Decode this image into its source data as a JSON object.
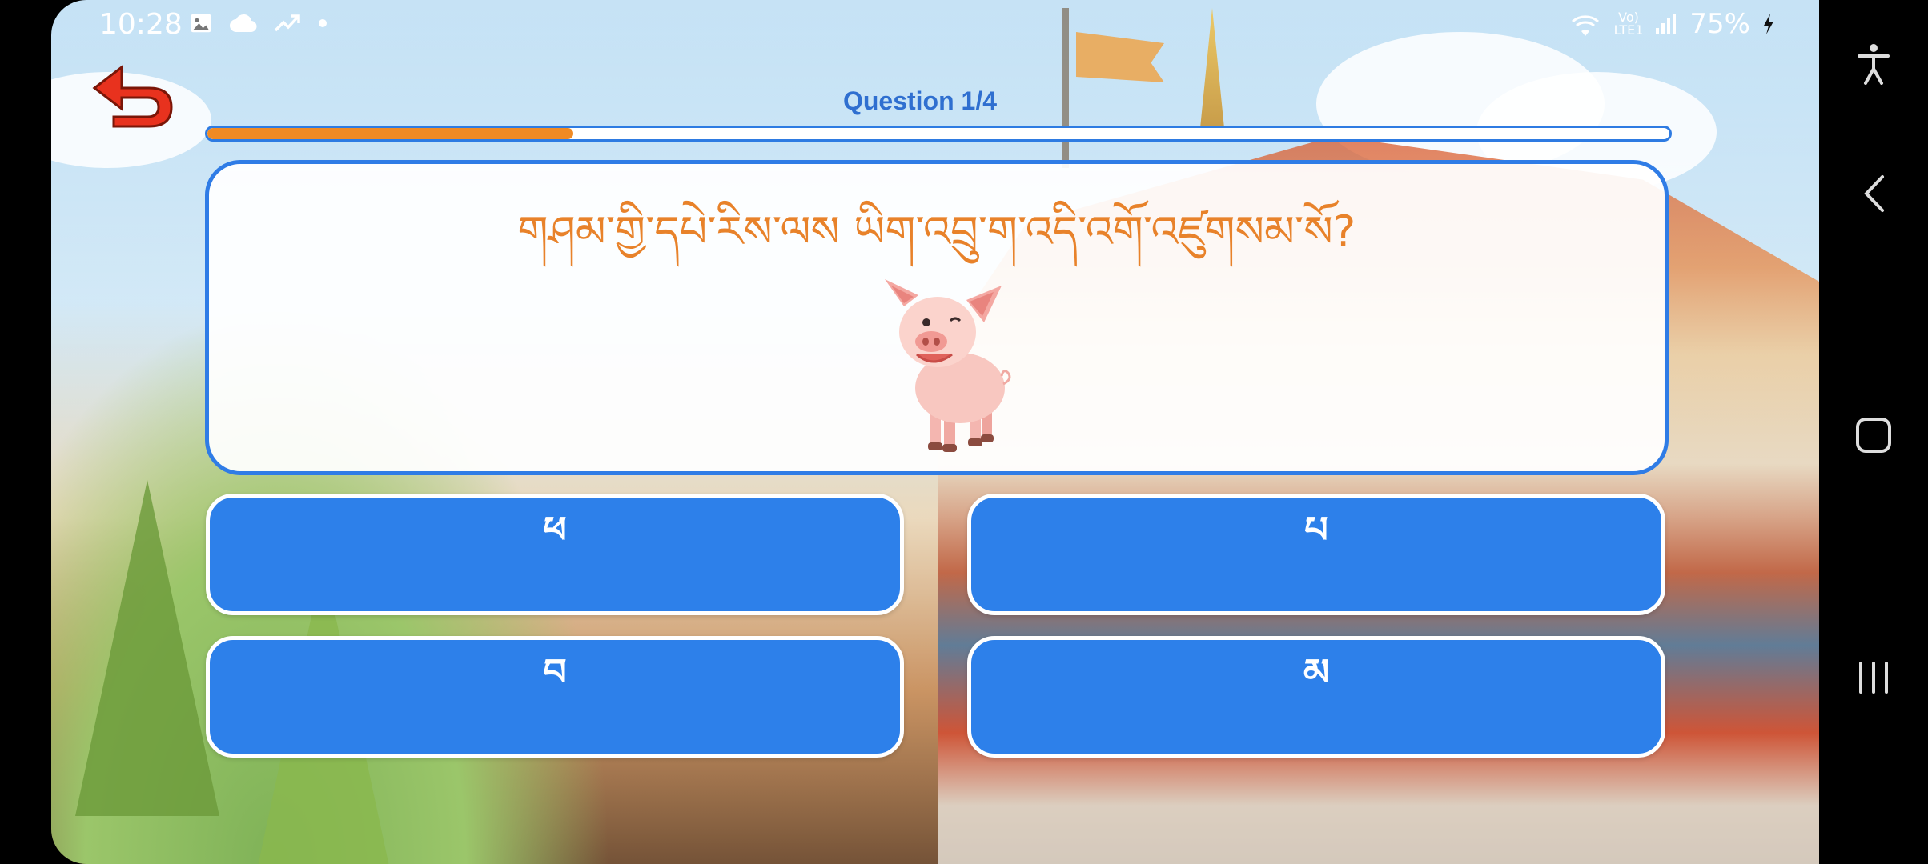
{
  "status_bar": {
    "time": "10:28",
    "left_icons": [
      "gallery-icon",
      "cloud-icon",
      "trending-icon",
      "dot-icon"
    ],
    "network_label_top": "Vo)",
    "network_label_bottom": "LTE1",
    "battery": "75%"
  },
  "navigation": {
    "buttons": [
      "accessibility-icon",
      "back-icon",
      "home-icon",
      "recents-icon"
    ]
  },
  "quiz": {
    "question_label": "Question 1/4",
    "progress_fraction": 0.25,
    "question_text": "གཤམ་གྱི་དཔེ་རིས་ལས ཡིག་འབྲུ་ག་འདི་འགོ་འཛུགསམ་སོ?",
    "image": "pig-illustration",
    "answers": [
      "ཕ",
      "པ",
      "བ",
      "མ"
    ]
  },
  "colors": {
    "accent_blue": "#2d80ea",
    "question_orange": "#e8822a",
    "progress_orange": "#f08a24",
    "back_arrow_red": "#e8321e"
  }
}
